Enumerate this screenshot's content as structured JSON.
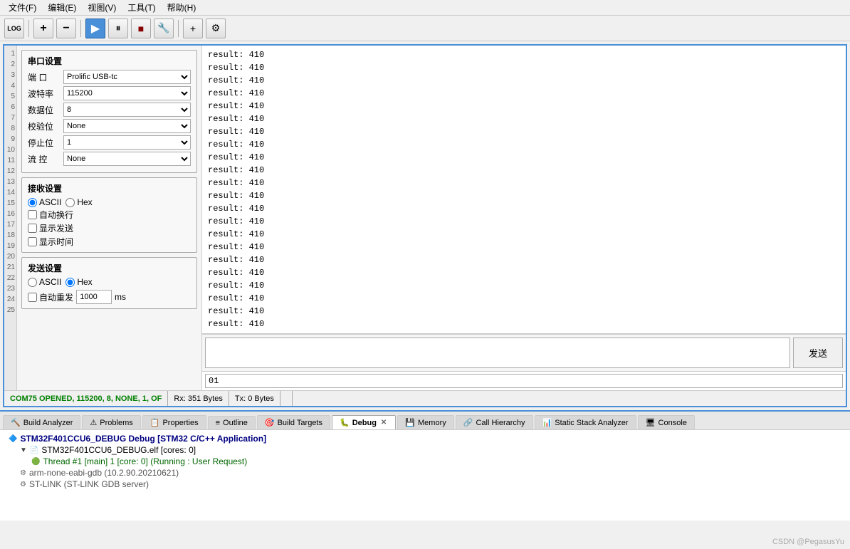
{
  "menubar": {
    "items": [
      {
        "label": "文件(F)"
      },
      {
        "label": "编辑(E)"
      },
      {
        "label": "视图(V)"
      },
      {
        "label": "工具(T)"
      },
      {
        "label": "帮助(H)"
      }
    ]
  },
  "toolbar": {
    "log_btn": "LOG",
    "play_icon": "▶",
    "pause_icon": "⏸",
    "stop_icon": "⏹",
    "plus_icon": "+",
    "gear_icon": "⚙"
  },
  "serial": {
    "port_settings_title": "串口设置",
    "port_label": "端  口",
    "port_value": "Prolific USB-tc",
    "baud_label": "波特率",
    "baud_value": "115200",
    "data_label": "数据位",
    "data_value": "8",
    "parity_label": "校验位",
    "parity_value": "None",
    "stop_label": "停止位",
    "stop_value": "1",
    "flow_label": "流  控",
    "flow_value": "None",
    "recv_settings_title": "接收设置",
    "recv_ascii": "ASCII",
    "recv_hex": "Hex",
    "auto_newline": "自动换行",
    "show_send": "显示发送",
    "show_time": "显示时间",
    "send_settings_title": "发送设置",
    "send_ascii": "ASCII",
    "send_hex": "Hex",
    "auto_resend": "自动重发",
    "interval_value": "1000",
    "ms_label": "ms",
    "send_btn": "发送",
    "hex_input_value": "01",
    "output_lines": [
      "result: 410",
      "result: 410",
      "result: 410",
      "result: 410",
      "result: 410",
      "result: 410",
      "result: 410",
      "result: 410",
      "result: 410",
      "result: 410",
      "result: 410",
      "result: 410",
      "result: 410",
      "result: 410",
      "result: 410",
      "result: 410",
      "result: 410",
      "result: 410",
      "result: 410",
      "result: 410",
      "result: 410",
      "result: 410"
    ]
  },
  "status": {
    "com_status": "COM75 OPENED, 115200, 8, NONE, 1, OF",
    "rx_label": "Rx: 351 Bytes",
    "tx_label": "Tx: 0 Bytes"
  },
  "ide_tabs": [
    {
      "label": "Build Analyzer",
      "icon": "🔨",
      "active": false
    },
    {
      "label": "Problems",
      "icon": "⚠",
      "active": false
    },
    {
      "label": "Properties",
      "icon": "📋",
      "active": false
    },
    {
      "label": "Outline",
      "icon": "≡",
      "active": false
    },
    {
      "label": "Build Targets",
      "icon": "🎯",
      "active": false
    },
    {
      "label": "Debug",
      "icon": "🐛",
      "active": true,
      "closeable": true
    },
    {
      "label": "Memory",
      "icon": "💾",
      "active": false
    },
    {
      "label": "Call Hierarchy",
      "icon": "🔗",
      "active": false
    },
    {
      "label": "Static Stack Analyzer",
      "icon": "📊",
      "active": false
    },
    {
      "label": "Console",
      "icon": "🖥",
      "active": false
    }
  ],
  "debug_tree": {
    "root": "STM32F401CCU6_DEBUG Debug [STM32 C/C++ Application]",
    "elf": "STM32F401CCU6_DEBUG.elf [cores: 0]",
    "thread": "Thread #1 [main] 1 [core: 0] (Running : User Request)",
    "gdb": "arm-none-eabi-gdb (10.2.90.20210621)",
    "stlink": "ST-LINK (ST-LINK GDB server)"
  },
  "watermark": "CSDN @PegasusYu",
  "line_numbers": [
    "1",
    "2",
    "3",
    "4",
    "5",
    "6",
    "7",
    "8",
    "9",
    "10",
    "11",
    "12",
    "13",
    "14",
    "15",
    "16",
    "17",
    "18",
    "19",
    "20",
    "21",
    "22",
    "23",
    "24",
    "25"
  ]
}
